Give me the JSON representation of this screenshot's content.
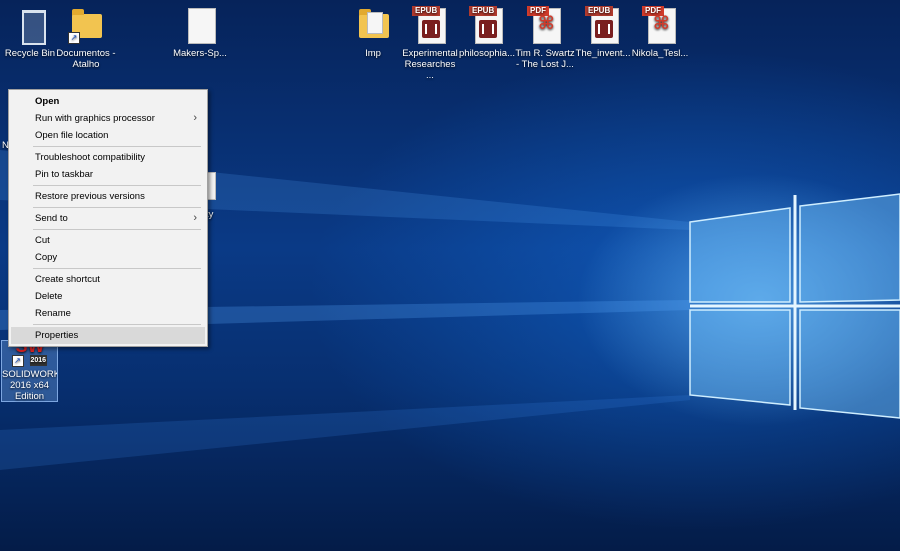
{
  "desktop": {
    "icons": [
      {
        "label": "Recycle Bin"
      },
      {
        "label": "Documentos - Atalho"
      },
      {
        "label": "Makers-Sp..."
      },
      {
        "label": "Imp"
      },
      {
        "label": "Experimental Researches ...",
        "badge": "EPUB"
      },
      {
        "label": "philosophia...",
        "badge": "EPUB"
      },
      {
        "label": "Tim R. Swartz - The Lost J...",
        "badge": "PDF"
      },
      {
        "label": "The_invent...",
        "badge": "EPUB"
      },
      {
        "label": "Nikola_Tesl...",
        "badge": "PDF"
      },
      {
        "label": "SOLIDWORKS 2016 x64 Edition",
        "badge": "2016",
        "glyph_text": "SW"
      }
    ],
    "partial_labels": [
      "N",
      "ty"
    ]
  },
  "context_menu": {
    "items": [
      {
        "label": "Open"
      },
      {
        "label": "Run with graphics processor",
        "submenu": true
      },
      {
        "label": "Open file location"
      },
      {
        "label": "Troubleshoot compatibility"
      },
      {
        "label": "Pin to taskbar"
      },
      {
        "label": "Restore previous versions"
      },
      {
        "label": "Send to",
        "submenu": true
      },
      {
        "label": "Cut"
      },
      {
        "label": "Copy"
      },
      {
        "label": "Create shortcut"
      },
      {
        "label": "Delete"
      },
      {
        "label": "Rename"
      },
      {
        "label": "Properties"
      }
    ],
    "submenu_arrow": "›",
    "highlighted_item": "Properties"
  },
  "colors": {
    "wallpaper_dark": "#06235a",
    "wallpaper_glow": "#78c8ff",
    "menu_bg": "#f2f2f2",
    "menu_hover": "#d9d9d9"
  }
}
